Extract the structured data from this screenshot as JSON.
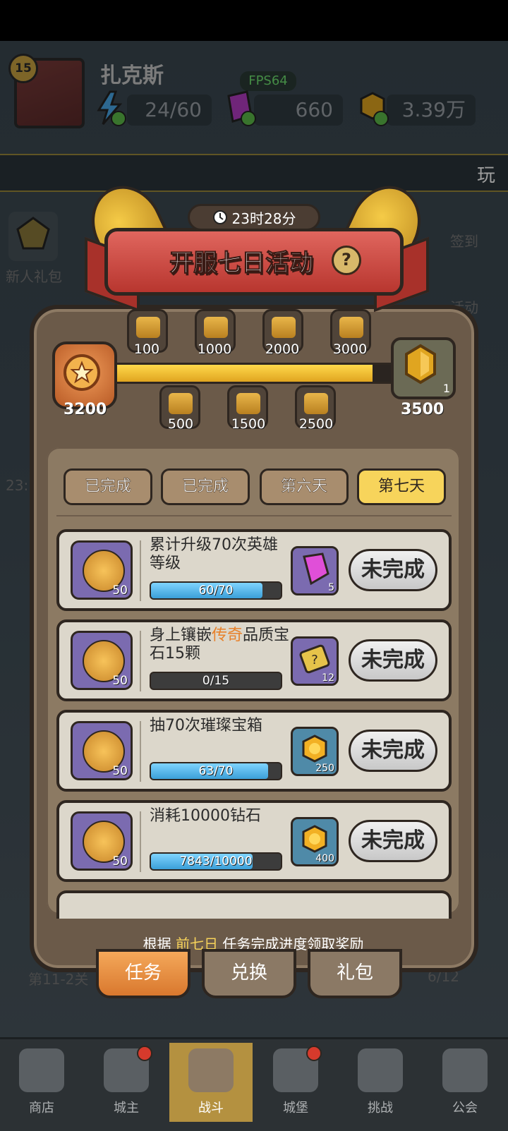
{
  "hud": {
    "level": "15",
    "player_name": "扎克斯",
    "fps": "FPS64",
    "energy": "24/60",
    "gems": "660",
    "gold": "3.39万",
    "menu_play": "玩"
  },
  "side": {
    "newbie_gift": "新人礼包",
    "checkin": "签到",
    "activity": "活动",
    "timer_small": "23:",
    "stage": "第11-2关",
    "stars": "6/12"
  },
  "event": {
    "timer": "23时28分",
    "title": "开服七日活动",
    "help": "?",
    "current_points": "3200",
    "max_points": "3500",
    "progress": 0.914,
    "final_reward_count": "1",
    "milestones_top": [
      "100",
      "1000",
      "2000",
      "3000"
    ],
    "milestones_bottom": [
      "500",
      "1500",
      "2500"
    ],
    "tabs": [
      "已完成",
      "已完成",
      "第六天",
      "第七天"
    ],
    "active_tab": 3,
    "tasks": [
      {
        "points": "50",
        "title": "累计升级70次英雄等级",
        "progress_text": "60/70",
        "progress": 0.857,
        "reward_icon": "pink-gem-icon",
        "reward_count": "5",
        "button": "未完成"
      },
      {
        "points": "50",
        "title_pre": "身上镶嵌",
        "title_hl": "传奇",
        "title_post": "品质宝石15颗",
        "progress_text": "0/15",
        "progress": 0.0,
        "reward_icon": "mystery-ticket-icon",
        "reward_count": "12",
        "button": "未完成"
      },
      {
        "points": "50",
        "title": "抽70次璀璨宝箱",
        "progress_text": "63/70",
        "progress": 0.9,
        "reward_icon": "gold-coin-icon",
        "reward_count": "250",
        "button": "未完成"
      },
      {
        "points": "50",
        "title": "消耗10000钻石",
        "progress_text": "7843/10000",
        "progress": 0.784,
        "reward_icon": "gold-coin-icon",
        "reward_count": "400",
        "button": "未完成"
      }
    ],
    "footer_pre": "根据",
    "footer_hl": "前七日",
    "footer_post": "任务完成进度领取奖励",
    "bottom_tabs": [
      "任务",
      "兑换",
      "礼包"
    ]
  },
  "nav": [
    "商店",
    "城主",
    "战斗",
    "城堡",
    "挑战",
    "公会"
  ],
  "colors": {
    "accent_gold": "#f7d45b",
    "progress_blue": "#3b9fd8",
    "highlight_orange": "#e8812a"
  }
}
